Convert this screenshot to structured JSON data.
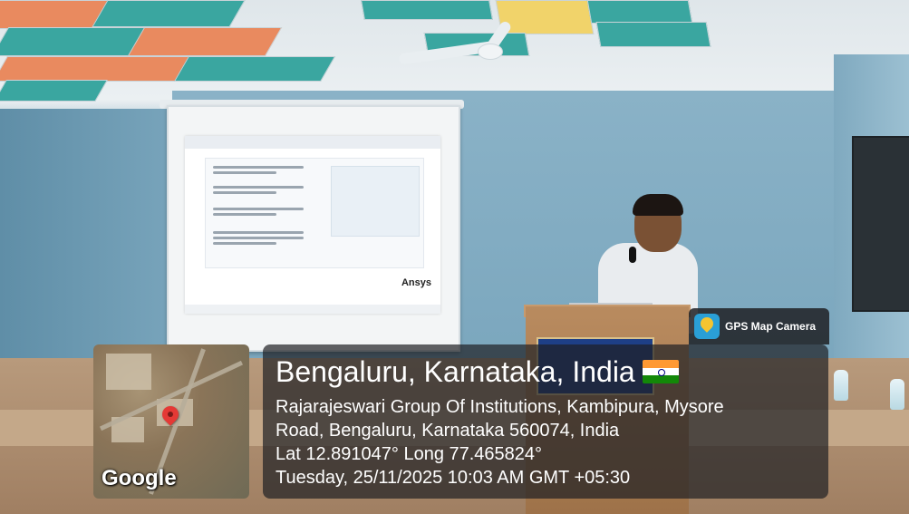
{
  "overlay": {
    "app_badge": "GPS Map Camera",
    "map_attribution": "Google",
    "place_title": "Bengaluru, Karnataka, India",
    "address_line1": "Rajarajeswari Group Of Institutions, Kambipura, Mysore",
    "address_line2": "Road, Bengaluru, Karnataka 560074, India",
    "coordinates": "Lat 12.891047° Long 77.465824°",
    "datetime": "Tuesday, 25/11/2025 10:03 AM GMT +05:30",
    "flag_icon": "india-flag-icon"
  },
  "scene": {
    "slide_brand": "Ansys"
  },
  "colors": {
    "wall": "#7aa6bd",
    "podium": "#b98b5f",
    "overlay_bg": "#1e2023",
    "pin": "#e53935"
  }
}
